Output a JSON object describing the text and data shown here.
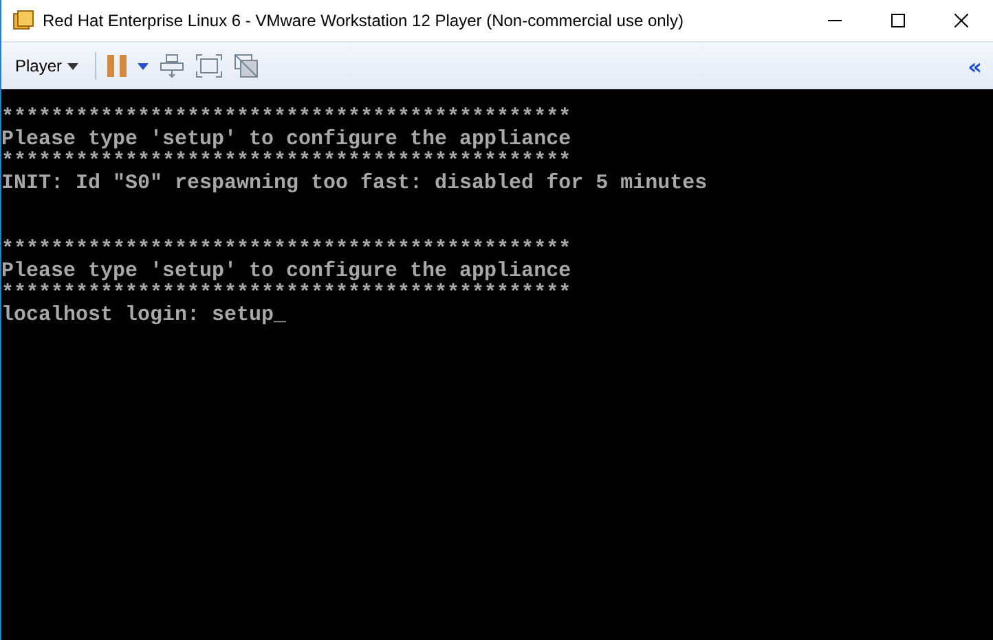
{
  "window": {
    "title": "Red Hat Enterprise Linux 6 - VMware Workstation 12 Player (Non-commercial use only)"
  },
  "toolbar": {
    "menu": "Player",
    "collapse": "«"
  },
  "console": {
    "blocks": [
      [
        "**********************************************",
        "Please type 'setup' to configure the appliance",
        "**********************************************",
        "INIT: Id \"S0\" respawning too fast: disabled for 5 minutes"
      ],
      [
        "**********************************************",
        "Please type 'setup' to configure the appliance",
        "**********************************************",
        "localhost login: setup_"
      ]
    ]
  }
}
